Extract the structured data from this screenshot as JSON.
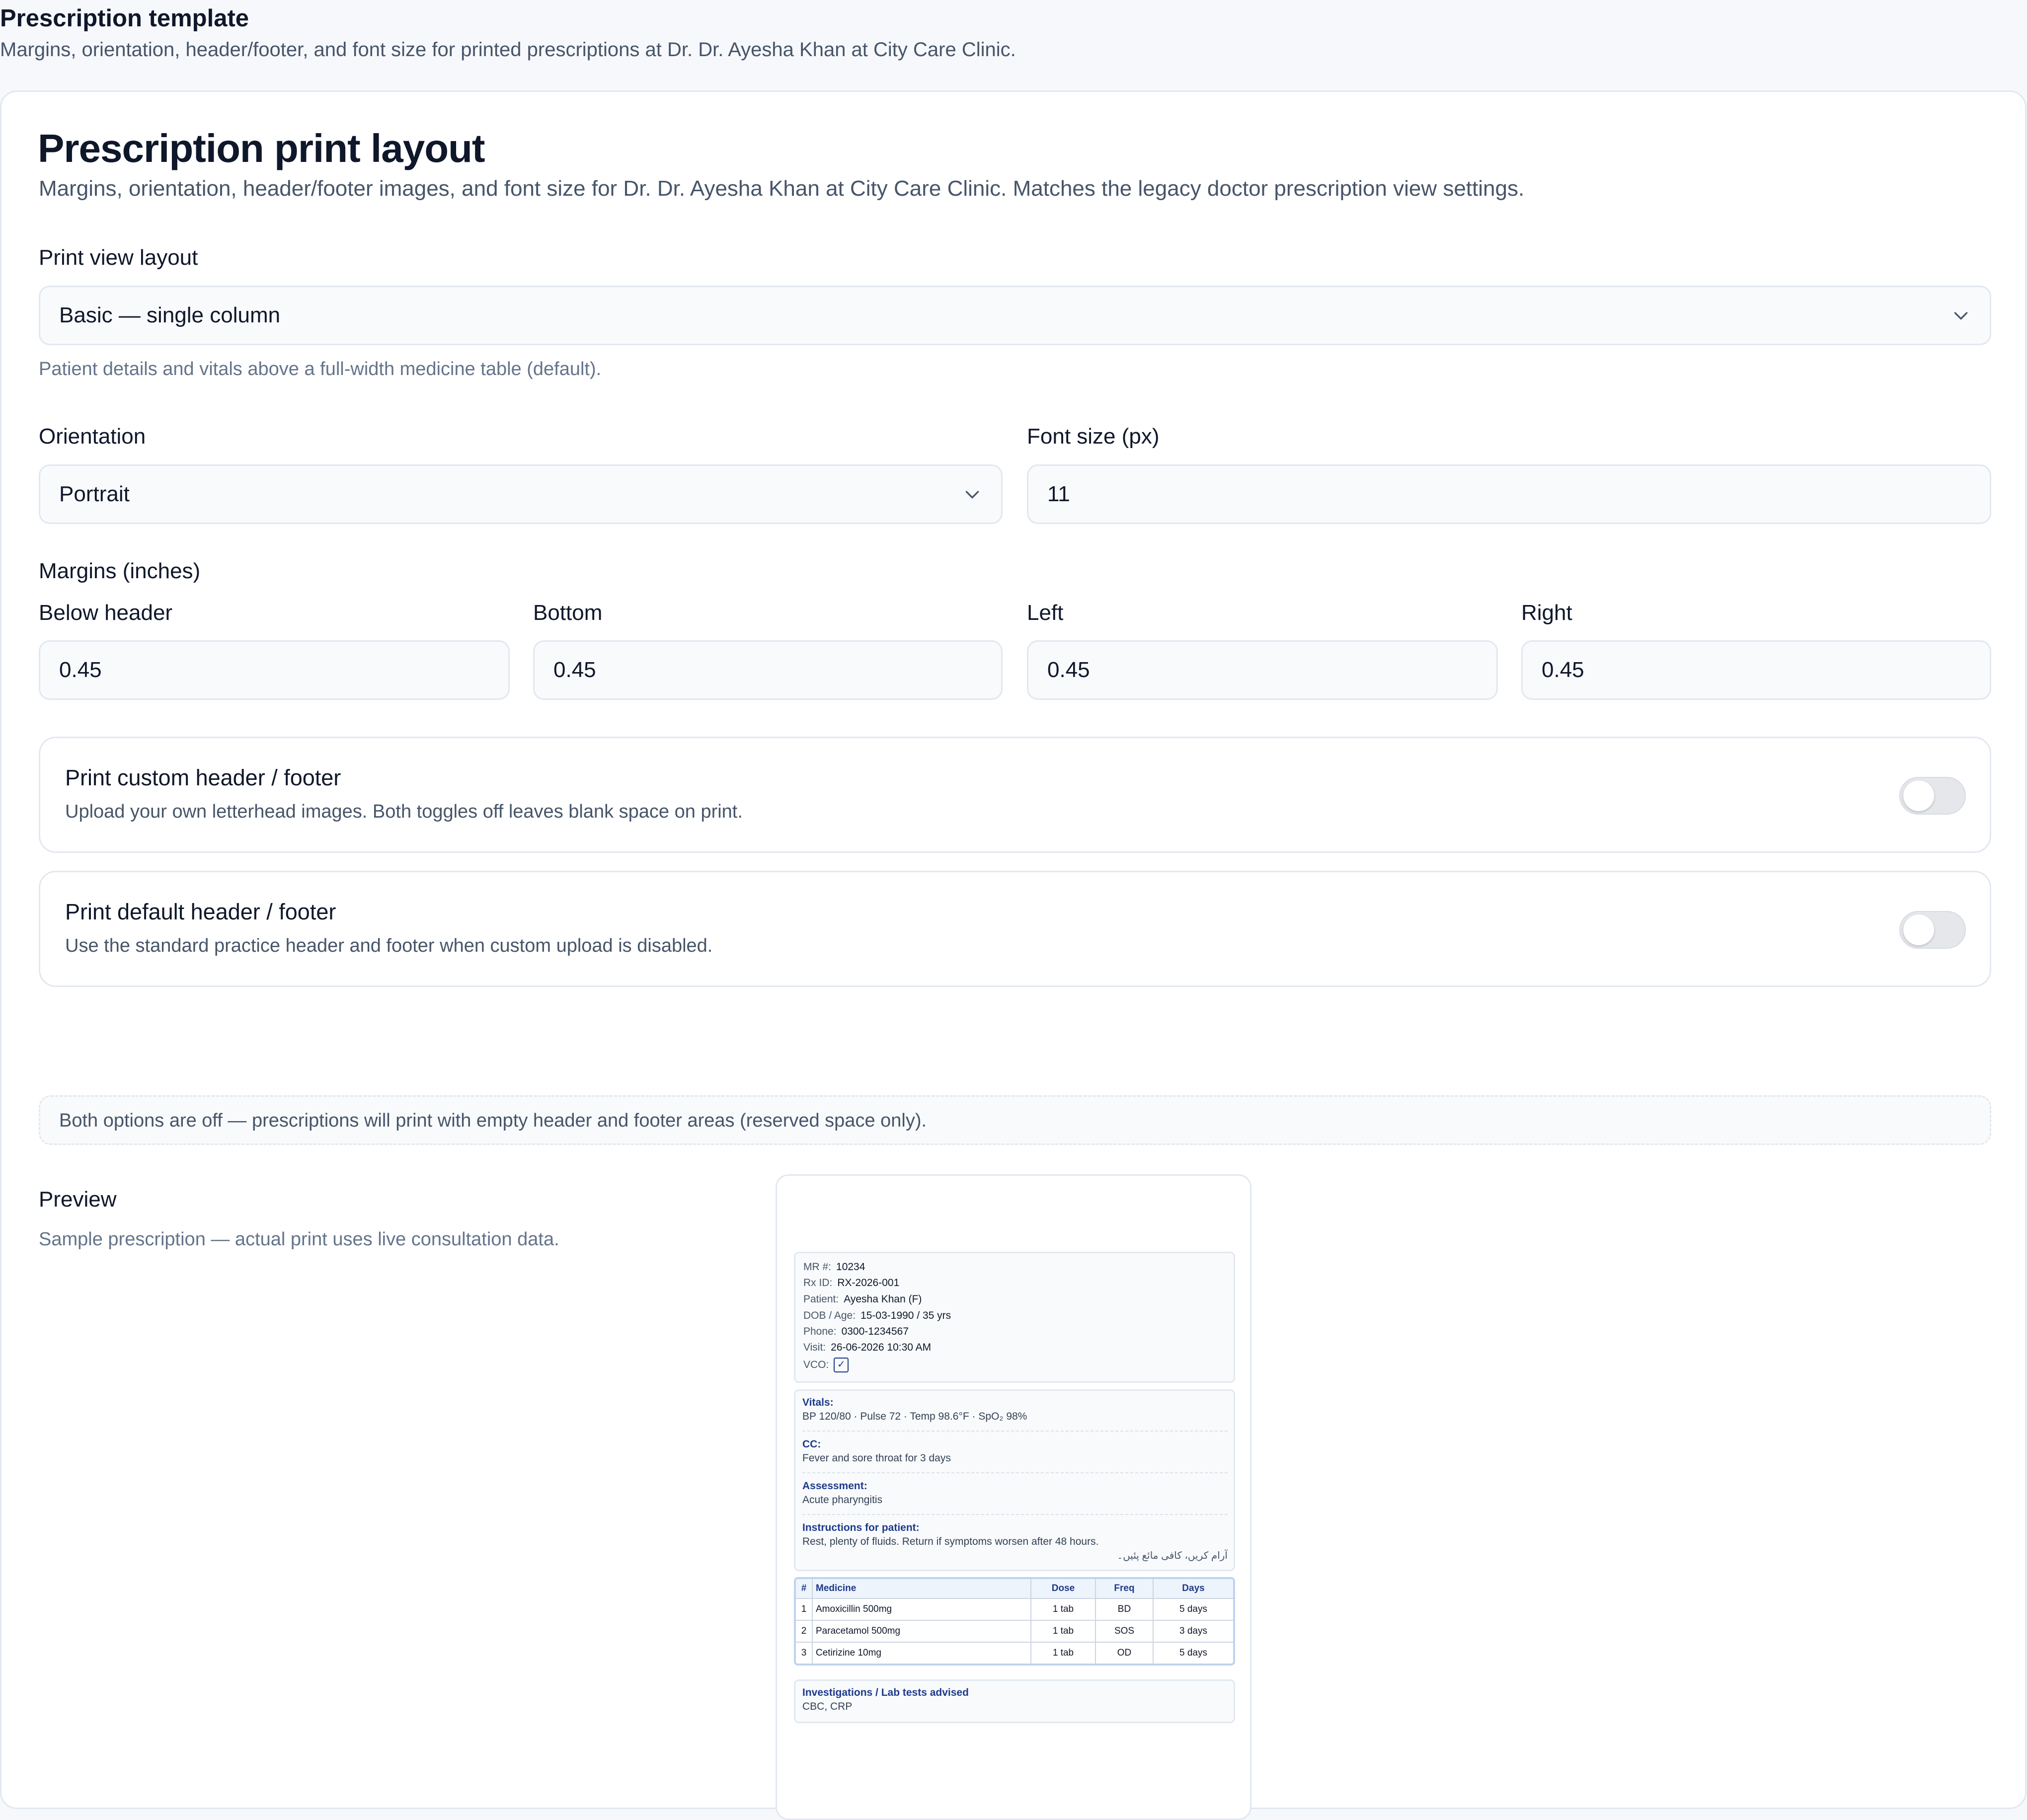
{
  "page": {
    "title": "Prescription template",
    "subtitle": "Margins, orientation, header/footer, and font size for printed prescriptions at Dr. Dr. Ayesha Khan at City Care Clinic."
  },
  "card": {
    "title": "Prescription print layout",
    "description": "Margins, orientation, header/footer images, and font size for Dr. Dr. Ayesha Khan at City Care Clinic. Matches the legacy doctor prescription view settings."
  },
  "layout": {
    "label": "Print view layout",
    "value": "Basic — single column",
    "help": "Patient details and vitals above a full-width medicine table (default)."
  },
  "orientation": {
    "label": "Orientation",
    "value": "Portrait"
  },
  "font_size": {
    "label": "Font size (px)",
    "value": "11"
  },
  "margins": {
    "label": "Margins (inches)",
    "below_header": {
      "label": "Below header",
      "value": "0.45"
    },
    "bottom": {
      "label": "Bottom",
      "value": "0.45"
    },
    "left": {
      "label": "Left",
      "value": "0.45"
    },
    "right": {
      "label": "Right",
      "value": "0.45"
    }
  },
  "custom_header": {
    "title": "Print custom header / footer",
    "description": "Upload your own letterhead images. Both toggles off leaves blank space on print.",
    "enabled": false
  },
  "default_header": {
    "title": "Print default header / footer",
    "description": "Use the standard practice header and footer when custom upload is disabled.",
    "enabled": false
  },
  "notice": "Both options are off — prescriptions will print with empty header and footer areas (reserved space only).",
  "preview": {
    "label": "Preview",
    "help": "Sample prescription — actual print uses live consultation data.",
    "patient": [
      {
        "k": "MR #:",
        "v": "10234"
      },
      {
        "k": "Rx ID:",
        "v": "RX-2026-001"
      },
      {
        "k": "Patient:",
        "v": "Ayesha Khan (F)"
      },
      {
        "k": "DOB / Age:",
        "v": "15-03-1990 / 35 yrs"
      },
      {
        "k": "Phone:",
        "v": "0300-1234567"
      },
      {
        "k": "Visit:",
        "v": "26-06-2026 10:30 AM"
      },
      {
        "k": "VCO:",
        "v": "✓"
      }
    ],
    "vitals": {
      "h": "Vitals:",
      "b": "BP 120/80 · Pulse 72 · Temp 98.6°F · SpO₂ 98%"
    },
    "cc": {
      "h": "CC:",
      "b": "Fever and sore throat for 3 days"
    },
    "assessment": {
      "h": "Assessment:",
      "b": "Acute pharyngitis"
    },
    "instructions": {
      "h": "Instructions for patient:",
      "b": "Rest, plenty of fluids. Return if symptoms worsen after 48 hours.",
      "urdu": "آرام کریں، کافی مائع پئیں۔"
    },
    "table": {
      "headers": [
        "#",
        "Medicine",
        "Dose",
        "Freq",
        "Days"
      ],
      "rows": [
        [
          "1",
          "Amoxicillin 500mg",
          "1 tab",
          "BD",
          "5 days"
        ],
        [
          "2",
          "Paracetamol 500mg",
          "1 tab",
          "SOS",
          "3 days"
        ],
        [
          "3",
          "Cetirizine 10mg",
          "1 tab",
          "OD",
          "5 days"
        ]
      ]
    },
    "investigations": {
      "h": "Investigations / Lab tests advised",
      "b": "CBC, CRP"
    }
  },
  "icons": {
    "select_chevron": "chevron-down-icon",
    "vco_check": "check-icon"
  },
  "colors": {
    "accent": "#1e3a8a",
    "border": "#e2e8f0",
    "muted": "#64748b",
    "toggle_off": "#e5e7eb"
  }
}
